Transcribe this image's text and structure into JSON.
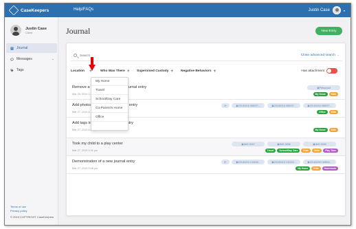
{
  "app": {
    "name": "CaseKeepers",
    "help_link": "Help/FAQs",
    "user_name": "Justin Case"
  },
  "sidebar": {
    "profile_name": "Justin Case",
    "profile_role": "Client",
    "items": [
      {
        "label": "Journal"
      },
      {
        "label": "Messages"
      },
      {
        "label": "Tags"
      }
    ],
    "footer_terms": "Terms of use",
    "footer_privacy": "Privacy policy",
    "copyright": "© 2019 COPYRIGHT CaseKeepers"
  },
  "main": {
    "title": "Journal",
    "new_entry_label": "New Entry",
    "search_placeholder": "Search",
    "close_advanced": "Close advanced search →",
    "filters": {
      "location": "Location",
      "who": "Who Was There",
      "supervision": "Supervised Custody",
      "negative": "Negative Behaviors",
      "has_attachment": "Has attachment"
    },
    "location_options": [
      "My Home",
      "Travel",
      "School/Day Care",
      "Co-Parent's Home",
      "Office"
    ],
    "entries": [
      {
        "title": "Remove a tag from an existing journal entry",
        "date": "Mar 28, 2019 1:21 pm",
        "attachments": [
          "Pdfupload"
        ],
        "tags": [
          {
            "label": "My Home",
            "color": "#2aa23f"
          },
          {
            "label": "Kids",
            "color": "#f0a43a"
          }
        ]
      },
      {
        "title": "Add photos to an existing journal entry",
        "date": "Mar 27, 2019 4:12 pm",
        "more": "3+",
        "attachments": [
          "20180216 085037...",
          "20180216 085037...",
          "20180216 085037..."
        ],
        "tags": [
          {
            "label": "Office",
            "color": "#2aa23f"
          },
          {
            "label": "Kids",
            "color": "#f0a43a"
          }
        ]
      },
      {
        "title": "Add tags to an existing journal entry",
        "date": "Mar 27, 2019 4:08 pm",
        "attachments": [],
        "tags": [
          {
            "label": "My Home",
            "color": "#2aa23f"
          },
          {
            "label": "Kids",
            "color": "#f0a43a"
          }
        ]
      },
      {
        "title": "Took my child to a play center",
        "date": "Mar 27, 2019 3:31 pm",
        "attachments": [
          "IMG 0097",
          "IMG 0098",
          "IMG 0099"
        ],
        "tags": [
          {
            "label": "Travel",
            "color": "#2aa23f"
          },
          {
            "label": "School/Day Care",
            "color": "#2aa23f"
          },
          {
            "label": "Kids",
            "color": "#f0a43a"
          },
          {
            "label": "Child",
            "color": "#f0a43a"
          },
          {
            "label": "Play Time",
            "color": "#b05cc0"
          }
        ]
      },
      {
        "title": "Demonstration of a new journal entry",
        "date": "Mar 27, 2019 3:08 pm",
        "more": "5+",
        "attachments": [
          "20180215 130408...",
          "20180215 131024...",
          "20180209 165846..."
        ],
        "tags": [
          {
            "label": "My Home",
            "color": "#2aa23f"
          },
          {
            "label": "Kids",
            "color": "#f0a43a"
          },
          {
            "label": "Homework",
            "color": "#b05cc0"
          }
        ]
      }
    ]
  },
  "colors": {
    "topbar": "#2e6fb0",
    "primary_green": "#41b061",
    "toggle_red": "#ef4f4a",
    "annotation_arrow": "#e40000"
  }
}
